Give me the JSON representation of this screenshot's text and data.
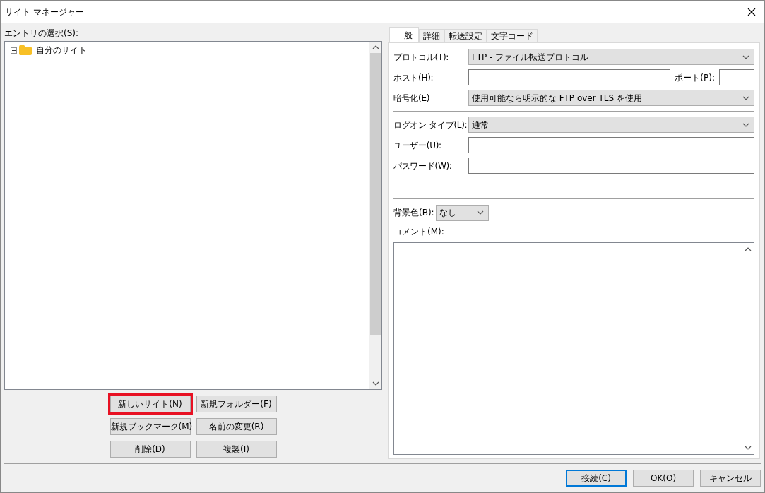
{
  "window": {
    "title": "サイト マネージャー"
  },
  "entries": {
    "label": "エントリの選択(S):",
    "tree": [
      {
        "label": "自分のサイト",
        "expanded": true
      }
    ]
  },
  "entry_buttons": [
    {
      "label": "新しいサイト(N)",
      "highlighted": true
    },
    {
      "label": "新規フォルダー(F)",
      "highlighted": false
    },
    {
      "label": "新規ブックマーク(M)",
      "highlighted": false
    },
    {
      "label": "名前の変更(R)",
      "highlighted": false
    },
    {
      "label": "削除(D)",
      "highlighted": false
    },
    {
      "label": "複製(I)",
      "highlighted": false
    }
  ],
  "tabs": [
    {
      "label": "一般",
      "selected": true
    },
    {
      "label": "詳細",
      "selected": false
    },
    {
      "label": "転送設定",
      "selected": false
    },
    {
      "label": "文字コード",
      "selected": false
    }
  ],
  "general": {
    "protocol": {
      "label": "プロトコル(T):",
      "value": "FTP - ファイル転送プロトコル"
    },
    "host": {
      "label": "ホスト(H):"
    },
    "port": {
      "label": "ポート(P):"
    },
    "encryption": {
      "label": "暗号化(E)",
      "value": "使用可能なら明示的な FTP over TLS を使用"
    },
    "logon_type": {
      "label": "ログオン タイプ(L):",
      "value": "通常"
    },
    "user": {
      "label": "ユーザー(U):"
    },
    "password": {
      "label": "パスワード(W):"
    },
    "background_color": {
      "label": "背景色(B):",
      "value": "なし"
    },
    "comment": {
      "label": "コメント(M):"
    }
  },
  "dialog_buttons": [
    {
      "label": "接続(C)",
      "default": true
    },
    {
      "label": "OK(O)",
      "default": false
    },
    {
      "label": "キャンセル",
      "default": false
    }
  ]
}
